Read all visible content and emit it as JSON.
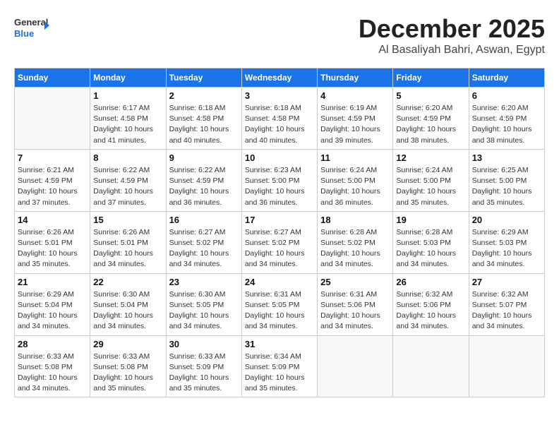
{
  "logo": {
    "line1": "General",
    "line2": "Blue",
    "icon": "▶"
  },
  "title": "December 2025",
  "location": "Al Basaliyah Bahri, Aswan, Egypt",
  "weekdays": [
    "Sunday",
    "Monday",
    "Tuesday",
    "Wednesday",
    "Thursday",
    "Friday",
    "Saturday"
  ],
  "weeks": [
    [
      {
        "day": "",
        "sunrise": "",
        "sunset": "",
        "daylight": ""
      },
      {
        "day": "1",
        "sunrise": "Sunrise: 6:17 AM",
        "sunset": "Sunset: 4:58 PM",
        "daylight": "Daylight: 10 hours and 41 minutes."
      },
      {
        "day": "2",
        "sunrise": "Sunrise: 6:18 AM",
        "sunset": "Sunset: 4:58 PM",
        "daylight": "Daylight: 10 hours and 40 minutes."
      },
      {
        "day": "3",
        "sunrise": "Sunrise: 6:18 AM",
        "sunset": "Sunset: 4:58 PM",
        "daylight": "Daylight: 10 hours and 40 minutes."
      },
      {
        "day": "4",
        "sunrise": "Sunrise: 6:19 AM",
        "sunset": "Sunset: 4:59 PM",
        "daylight": "Daylight: 10 hours and 39 minutes."
      },
      {
        "day": "5",
        "sunrise": "Sunrise: 6:20 AM",
        "sunset": "Sunset: 4:59 PM",
        "daylight": "Daylight: 10 hours and 38 minutes."
      },
      {
        "day": "6",
        "sunrise": "Sunrise: 6:20 AM",
        "sunset": "Sunset: 4:59 PM",
        "daylight": "Daylight: 10 hours and 38 minutes."
      }
    ],
    [
      {
        "day": "7",
        "sunrise": "Sunrise: 6:21 AM",
        "sunset": "Sunset: 4:59 PM",
        "daylight": "Daylight: 10 hours and 37 minutes."
      },
      {
        "day": "8",
        "sunrise": "Sunrise: 6:22 AM",
        "sunset": "Sunset: 4:59 PM",
        "daylight": "Daylight: 10 hours and 37 minutes."
      },
      {
        "day": "9",
        "sunrise": "Sunrise: 6:22 AM",
        "sunset": "Sunset: 4:59 PM",
        "daylight": "Daylight: 10 hours and 36 minutes."
      },
      {
        "day": "10",
        "sunrise": "Sunrise: 6:23 AM",
        "sunset": "Sunset: 5:00 PM",
        "daylight": "Daylight: 10 hours and 36 minutes."
      },
      {
        "day": "11",
        "sunrise": "Sunrise: 6:24 AM",
        "sunset": "Sunset: 5:00 PM",
        "daylight": "Daylight: 10 hours and 36 minutes."
      },
      {
        "day": "12",
        "sunrise": "Sunrise: 6:24 AM",
        "sunset": "Sunset: 5:00 PM",
        "daylight": "Daylight: 10 hours and 35 minutes."
      },
      {
        "day": "13",
        "sunrise": "Sunrise: 6:25 AM",
        "sunset": "Sunset: 5:00 PM",
        "daylight": "Daylight: 10 hours and 35 minutes."
      }
    ],
    [
      {
        "day": "14",
        "sunrise": "Sunrise: 6:26 AM",
        "sunset": "Sunset: 5:01 PM",
        "daylight": "Daylight: 10 hours and 35 minutes."
      },
      {
        "day": "15",
        "sunrise": "Sunrise: 6:26 AM",
        "sunset": "Sunset: 5:01 PM",
        "daylight": "Daylight: 10 hours and 34 minutes."
      },
      {
        "day": "16",
        "sunrise": "Sunrise: 6:27 AM",
        "sunset": "Sunset: 5:02 PM",
        "daylight": "Daylight: 10 hours and 34 minutes."
      },
      {
        "day": "17",
        "sunrise": "Sunrise: 6:27 AM",
        "sunset": "Sunset: 5:02 PM",
        "daylight": "Daylight: 10 hours and 34 minutes."
      },
      {
        "day": "18",
        "sunrise": "Sunrise: 6:28 AM",
        "sunset": "Sunset: 5:02 PM",
        "daylight": "Daylight: 10 hours and 34 minutes."
      },
      {
        "day": "19",
        "sunrise": "Sunrise: 6:28 AM",
        "sunset": "Sunset: 5:03 PM",
        "daylight": "Daylight: 10 hours and 34 minutes."
      },
      {
        "day": "20",
        "sunrise": "Sunrise: 6:29 AM",
        "sunset": "Sunset: 5:03 PM",
        "daylight": "Daylight: 10 hours and 34 minutes."
      }
    ],
    [
      {
        "day": "21",
        "sunrise": "Sunrise: 6:29 AM",
        "sunset": "Sunset: 5:04 PM",
        "daylight": "Daylight: 10 hours and 34 minutes."
      },
      {
        "day": "22",
        "sunrise": "Sunrise: 6:30 AM",
        "sunset": "Sunset: 5:04 PM",
        "daylight": "Daylight: 10 hours and 34 minutes."
      },
      {
        "day": "23",
        "sunrise": "Sunrise: 6:30 AM",
        "sunset": "Sunset: 5:05 PM",
        "daylight": "Daylight: 10 hours and 34 minutes."
      },
      {
        "day": "24",
        "sunrise": "Sunrise: 6:31 AM",
        "sunset": "Sunset: 5:05 PM",
        "daylight": "Daylight: 10 hours and 34 minutes."
      },
      {
        "day": "25",
        "sunrise": "Sunrise: 6:31 AM",
        "sunset": "Sunset: 5:06 PM",
        "daylight": "Daylight: 10 hours and 34 minutes."
      },
      {
        "day": "26",
        "sunrise": "Sunrise: 6:32 AM",
        "sunset": "Sunset: 5:06 PM",
        "daylight": "Daylight: 10 hours and 34 minutes."
      },
      {
        "day": "27",
        "sunrise": "Sunrise: 6:32 AM",
        "sunset": "Sunset: 5:07 PM",
        "daylight": "Daylight: 10 hours and 34 minutes."
      }
    ],
    [
      {
        "day": "28",
        "sunrise": "Sunrise: 6:33 AM",
        "sunset": "Sunset: 5:08 PM",
        "daylight": "Daylight: 10 hours and 34 minutes."
      },
      {
        "day": "29",
        "sunrise": "Sunrise: 6:33 AM",
        "sunset": "Sunset: 5:08 PM",
        "daylight": "Daylight: 10 hours and 35 minutes."
      },
      {
        "day": "30",
        "sunrise": "Sunrise: 6:33 AM",
        "sunset": "Sunset: 5:09 PM",
        "daylight": "Daylight: 10 hours and 35 minutes."
      },
      {
        "day": "31",
        "sunrise": "Sunrise: 6:34 AM",
        "sunset": "Sunset: 5:09 PM",
        "daylight": "Daylight: 10 hours and 35 minutes."
      },
      {
        "day": "",
        "sunrise": "",
        "sunset": "",
        "daylight": ""
      },
      {
        "day": "",
        "sunrise": "",
        "sunset": "",
        "daylight": ""
      },
      {
        "day": "",
        "sunrise": "",
        "sunset": "",
        "daylight": ""
      }
    ]
  ]
}
